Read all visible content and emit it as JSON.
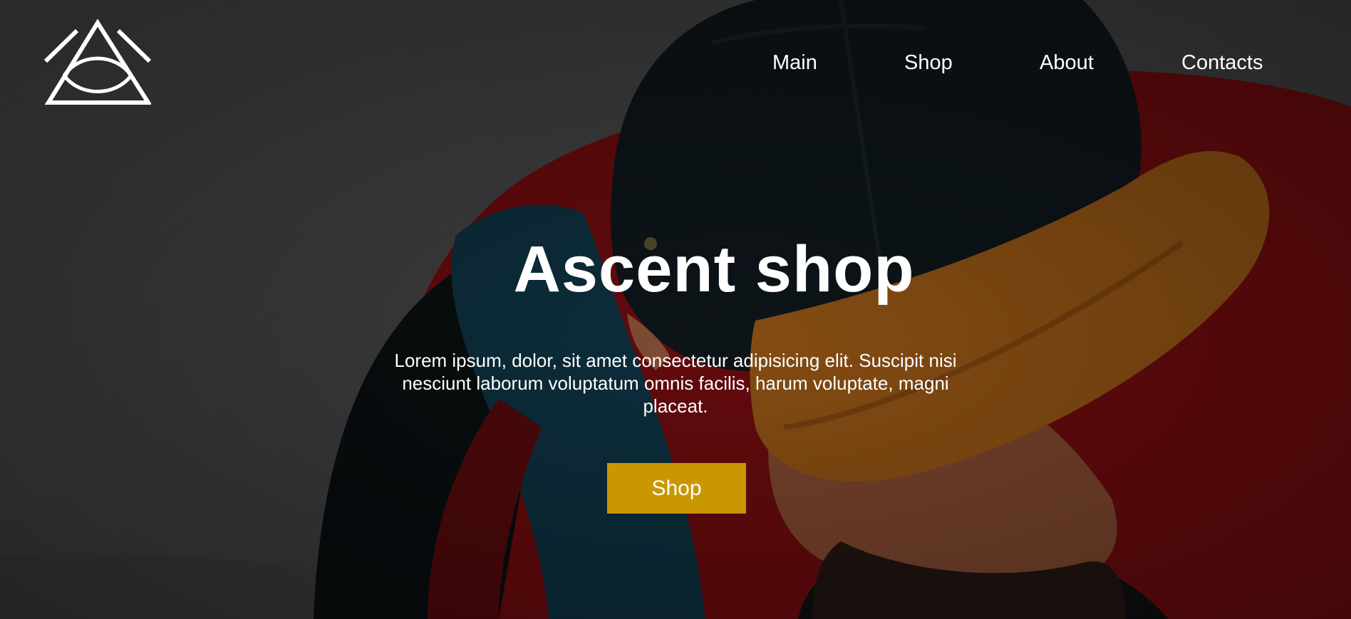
{
  "header": {
    "logo_icon": "triangle-eye-logo-icon",
    "nav": {
      "main": "Main",
      "shop": "Shop",
      "about": "About",
      "contacts": "Contacts"
    }
  },
  "hero": {
    "title": "Ascent shop",
    "description": "Lorem ipsum, dolor, sit amet consectetur adipisicing elit. Suscipit nisi nesciunt laborum voluptatum omnis facilis, harum voluptate, magni placeat.",
    "cta_label": "Shop",
    "background_image": "man-in-cap-photo"
  },
  "colors": {
    "accent": "#c99700",
    "text": "#ffffff"
  }
}
